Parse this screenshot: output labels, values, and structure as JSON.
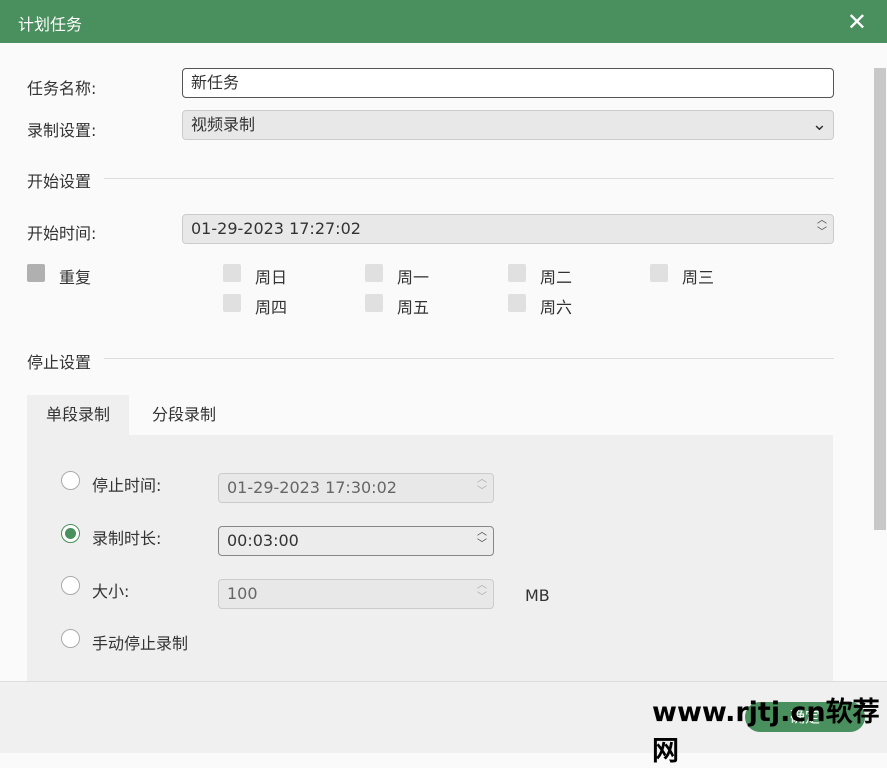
{
  "title": "计划任务",
  "task_name": {
    "label": "任务名称:",
    "value": "新任务"
  },
  "record_setting": {
    "label": "录制设置:",
    "value": "视频录制"
  },
  "start_section": "开始设置",
  "start_time": {
    "label": "开始时间:",
    "value": "01-29-2023 17:27:02"
  },
  "repeat": {
    "label": "重复",
    "days": [
      "周日",
      "周一",
      "周二",
      "周三",
      "周四",
      "周五",
      "周六"
    ]
  },
  "stop_section": "停止设置",
  "tabs": [
    "单段录制",
    "分段录制"
  ],
  "stop_time": {
    "label": "停止时间:",
    "value": "01-29-2023 17:30:02"
  },
  "duration": {
    "label": "录制时长:",
    "value": "00:03:00"
  },
  "size": {
    "label": "大小:",
    "value": "100",
    "unit": "MB"
  },
  "manual": "手动停止录制",
  "ok": "确定",
  "watermark": "www.rjtj.cn软荐网"
}
